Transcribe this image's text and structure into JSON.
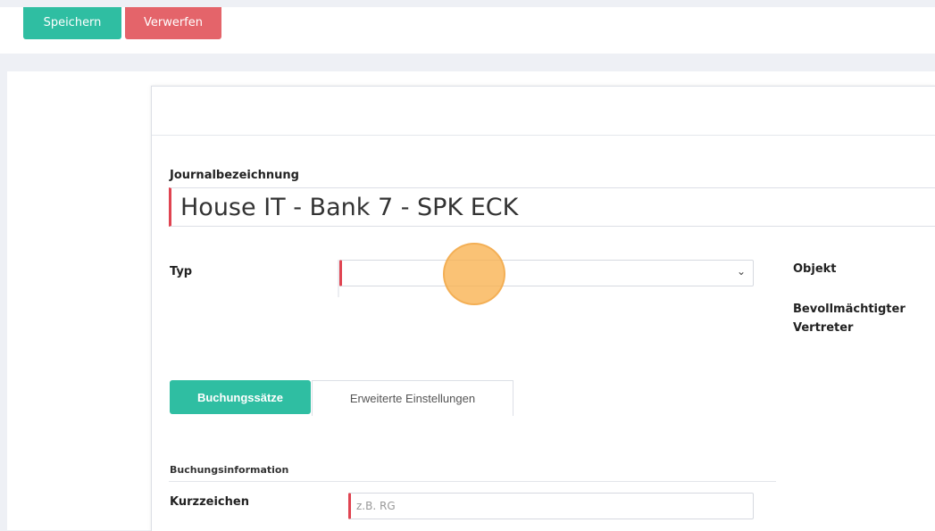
{
  "toolbar": {
    "save_label": "Speichern",
    "discard_label": "Verwerfen"
  },
  "form": {
    "journal_label": "Journalbezeichnung",
    "journal_value": "House IT - Bank 7 - SPK ECK",
    "type_label": "Typ",
    "type_value": "",
    "object_label": "Objekt",
    "representative_label": "Bevollmächtigter Vertreter"
  },
  "tabs": [
    {
      "label": "Buchungssätze",
      "active": true
    },
    {
      "label": "Erweiterte Einstellungen",
      "active": false
    }
  ],
  "booking": {
    "section_label": "Buchungsinformation",
    "shortcode_label": "Kurzzeichen",
    "shortcode_placeholder": "z.B. RG",
    "shortcode_value": ""
  },
  "icons": {
    "select_chevron": "chevron-down-icon"
  },
  "colors": {
    "primary": "#2fbea2",
    "danger": "#e4646a",
    "required_marker": "#e04451",
    "click_indicator": "#f9b14e"
  }
}
